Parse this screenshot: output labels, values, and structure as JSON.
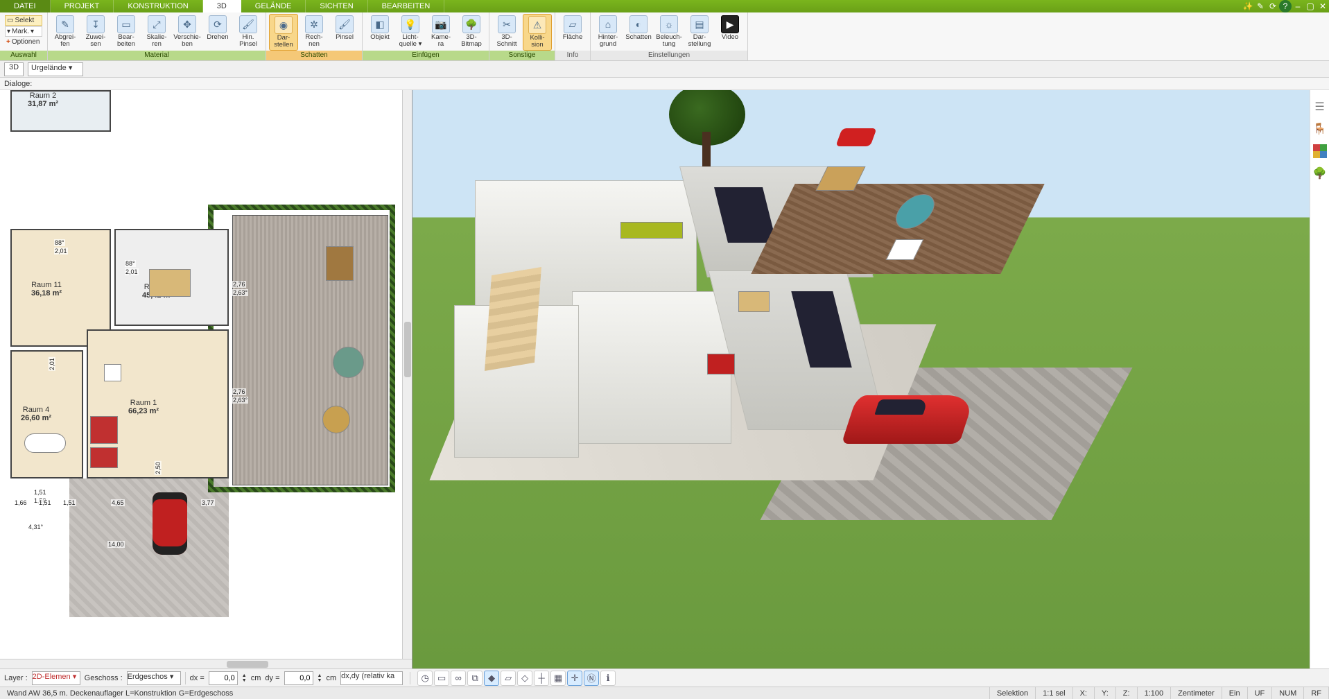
{
  "menu": {
    "tabs": [
      "DATEI",
      "PROJEKT",
      "KONSTRUKTION",
      "3D",
      "GELÄNDE",
      "SICHTEN",
      "BEARBEITEN"
    ],
    "active_index": 3
  },
  "titlebar_icons": [
    "wand-icon",
    "pencil-icon",
    "refresh-icon",
    "help-icon",
    "minimize-icon",
    "restore-icon",
    "close-icon"
  ],
  "selection_panel": {
    "select": "Selekt",
    "mark": "Mark.",
    "options": "Optionen"
  },
  "ribbon": {
    "groups": [
      {
        "name": "Auswahl",
        "style": "green",
        "tools": []
      },
      {
        "name": "Material",
        "style": "green",
        "tools": [
          {
            "id": "abgreifen",
            "l1": "Abgrei-",
            "l2": "fen",
            "glyph": "✎"
          },
          {
            "id": "zuweisen",
            "l1": "Zuwei-",
            "l2": "sen",
            "glyph": "↧"
          },
          {
            "id": "bearbeiten",
            "l1": "Bear-",
            "l2": "beiten",
            "glyph": "▭"
          },
          {
            "id": "skalieren",
            "l1": "Skalie-",
            "l2": "ren",
            "glyph": "⤢"
          },
          {
            "id": "verschieben",
            "l1": "Verschie-",
            "l2": "ben",
            "glyph": "✥"
          },
          {
            "id": "drehen",
            "l1": "Drehen",
            "l2": "",
            "glyph": "⟳"
          },
          {
            "id": "hin-pinsel",
            "l1": "Hin.",
            "l2": "Pinsel",
            "glyph": "🖌"
          }
        ]
      },
      {
        "name": "Schatten",
        "style": "orange",
        "tools": [
          {
            "id": "darstellen",
            "l1": "Dar-",
            "l2": "stellen",
            "glyph": "◉",
            "active": true
          },
          {
            "id": "rechnen",
            "l1": "Rech-",
            "l2": "nen",
            "glyph": "✲"
          },
          {
            "id": "pinsel",
            "l1": "Pinsel",
            "l2": "",
            "glyph": "🖌"
          }
        ]
      },
      {
        "name": "Einfügen",
        "style": "green",
        "tools": [
          {
            "id": "objekt",
            "l1": "Objekt",
            "l2": "",
            "glyph": "◧"
          },
          {
            "id": "lichtquelle",
            "l1": "Licht-",
            "l2": "quelle ▾",
            "glyph": "💡"
          },
          {
            "id": "kamera",
            "l1": "Kame-",
            "l2": "ra",
            "glyph": "📷"
          },
          {
            "id": "3d-bitmap",
            "l1": "3D-",
            "l2": "Bitmap",
            "glyph": "🌳"
          }
        ]
      },
      {
        "name": "Sonstige",
        "style": "green",
        "tools": [
          {
            "id": "3d-schnitt",
            "l1": "3D-",
            "l2": "Schnitt",
            "glyph": "✂"
          },
          {
            "id": "kollision",
            "l1": "Kolli-",
            "l2": "sion",
            "glyph": "⚠",
            "active": true
          }
        ]
      },
      {
        "name": "Info",
        "style": "plain",
        "tools": [
          {
            "id": "flaeche",
            "l1": "Fläche",
            "l2": "",
            "glyph": "▱"
          }
        ]
      },
      {
        "name": "Einstellungen",
        "style": "plain",
        "tools": [
          {
            "id": "hintergrund",
            "l1": "Hinter-",
            "l2": "grund",
            "glyph": "⌂"
          },
          {
            "id": "schatten-einst",
            "l1": "Schatten",
            "l2": "",
            "glyph": "◐"
          },
          {
            "id": "beleuchtung",
            "l1": "Beleuch-",
            "l2": "tung",
            "glyph": "☼"
          },
          {
            "id": "darstellung",
            "l1": "Dar-",
            "l2": "stellung",
            "glyph": "▤"
          },
          {
            "id": "video",
            "l1": "Video",
            "l2": "",
            "glyph": "▶"
          }
        ]
      }
    ]
  },
  "subbar": {
    "mode": "3D",
    "layer_select": "Urgelände"
  },
  "dialog_label": "Dialoge:",
  "plan": {
    "rooms": [
      {
        "name": "Raum 2",
        "area": "31,87 m²"
      },
      {
        "name": "Raum 11",
        "area": "36,18 m²"
      },
      {
        "name": "Raum 3",
        "area": "45,42 m²"
      },
      {
        "name": "Raum 4",
        "area": "26,60 m²"
      },
      {
        "name": "Raum 1",
        "area": "66,23 m²"
      }
    ],
    "dims": [
      "88°",
      "2,01",
      "88°",
      "2,01",
      "2,76",
      "2,63°",
      "2,76",
      "2,63°",
      "1,51",
      "1,50",
      "2,50",
      "2,01",
      "1,66",
      "1,51",
      "1,51",
      "4,65",
      "3,77",
      "4,31°",
      "14,00"
    ]
  },
  "scene": {
    "description": "Cutaway 3D house on lawn with terrace, furniture, trees, red car on paved driveway"
  },
  "gutter_icons": [
    "layers-icon",
    "furniture-icon",
    "palette-icon",
    "tree-icon"
  ],
  "bottom": {
    "layer_label": "Layer :",
    "layer_value": "2D-Elemen",
    "floor_label": "Geschoss :",
    "floor_value": "Erdgeschos",
    "dx_label": "dx =",
    "dx_value": "0,0",
    "dy_label": "dy =",
    "dy_value": "0,0",
    "unit": "cm",
    "dxdy_mode": "dx,dy (relativ ka",
    "spin": "÷",
    "icon_ids": [
      "clock-icon",
      "monitor-icon",
      "link-icon",
      "magnet-icon",
      "snap-endpoint-icon",
      "snap-edge-icon",
      "snap-face-icon",
      "ortho-icon",
      "grid-icon",
      "axis-icon",
      "north-icon",
      "info-icon"
    ],
    "selected_icons": [
      4,
      9,
      10
    ]
  },
  "status": {
    "message": "Wand AW 36,5 m. Deckenauflager L=Konstruktion G=Erdgeschoss",
    "selection": "Selektion",
    "sel_count": "1:1 sel",
    "coords": [
      "X:",
      "Y:",
      "Z:"
    ],
    "unit": "Zentimeter",
    "flags": [
      "Ein",
      "UF",
      "NUM",
      "RF"
    ],
    "scale": "1:100"
  }
}
